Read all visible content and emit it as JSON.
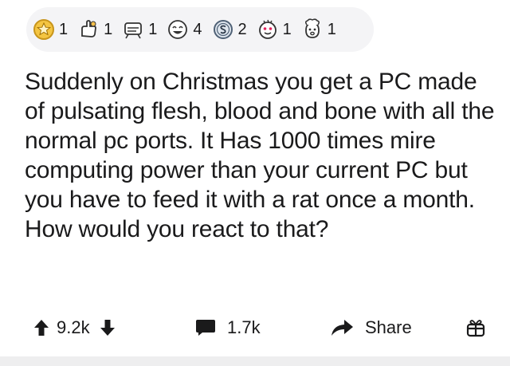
{
  "awards": [
    {
      "icon": "gold-star-award-icon",
      "count": "1"
    },
    {
      "icon": "wholesome-hand-award-icon",
      "count": "1"
    },
    {
      "icon": "hugz-award-icon",
      "count": "1"
    },
    {
      "icon": "laughing-face-award-icon",
      "count": "4"
    },
    {
      "icon": "silver-coin-award-icon",
      "count": "2"
    },
    {
      "icon": "starstruck-face-award-icon",
      "count": "1"
    },
    {
      "icon": "mindblown-face-award-icon",
      "count": "1"
    }
  ],
  "post": {
    "title": "Suddenly on Christmas you get a PC made of pulsating flesh, blood and bone with all the normal pc ports. It Has 1000 times mire computing power than your current PC but you have to feed it with a rat once a month. How would you react to that?"
  },
  "actions": {
    "vote_count": "9.2k",
    "comment_count": "1.7k",
    "share_label": "Share"
  },
  "colors": {
    "awards_bg": "#f4f4f6",
    "icon_gray": "#7c7c7c",
    "text": "#1a1a1b"
  }
}
